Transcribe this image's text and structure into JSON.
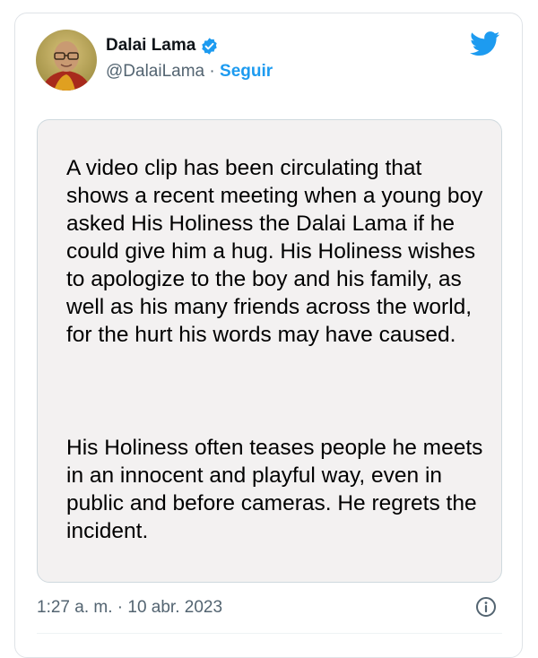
{
  "tweet": {
    "author_name": "Dalai Lama",
    "handle": "@DalaiLama",
    "separator": " · ",
    "follow_label": "Seguir",
    "paragraphs": [
      "A video clip has been circulating that shows a recent meeting when a young boy asked His Holiness the Dalai Lama if he could give him a hug. His Holiness wishes to apologize to the boy and his family, as well as his many friends across the world, for the hurt his words may have caused.",
      "His Holiness often teases people he meets in an innocent and playful way, even in public and before cameras. He regrets the incident."
    ],
    "timestamp": "1:27 a. m. · 10 abr. 2023"
  },
  "icons": {
    "verified": "verified-badge-icon",
    "brand": "twitter-bird-icon",
    "info": "info-icon"
  },
  "colors": {
    "accent": "#1d9bf0",
    "text_primary": "#0f1419",
    "text_secondary": "#536471",
    "media_background": "#f3f1f1"
  }
}
